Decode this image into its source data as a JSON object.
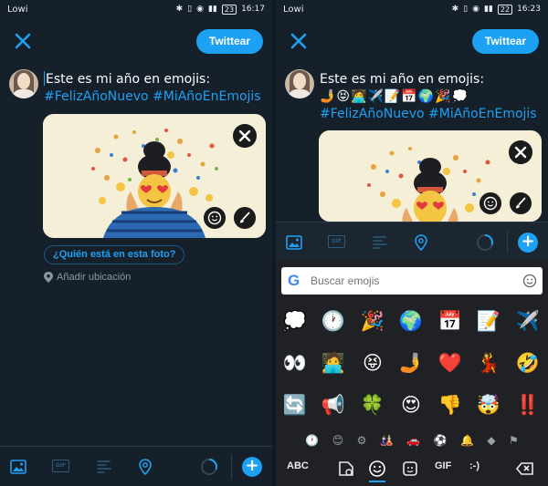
{
  "status_left": {
    "carrier": "Lowi",
    "battery": "23",
    "time": "16:17"
  },
  "status_right": {
    "carrier": "Lowi",
    "battery": "22",
    "time": "16:23"
  },
  "colors": {
    "accent": "#1da1f2",
    "background": "#15202b",
    "keyboard": "#202124"
  },
  "compose": {
    "tweet_button": "Twittear",
    "text_line1": "Este es mi año en emojis:",
    "text_tags": "#FelizAñoNuevo #MiAñoEnEmojis",
    "emoji_line": "🤳😝🧑‍💻✈️📝📅🌍🎉💭"
  },
  "media_actions": {
    "who_in_photo": "¿Quién está en esta foto?",
    "add_location": "Añadir ubicación"
  },
  "toolbar": {
    "gif_label": "GIF"
  },
  "emoji_keyboard": {
    "search_placeholder": "Buscar emojis",
    "google_logo": "G",
    "emojis": [
      "💭",
      "🕐",
      "🎉",
      "🌍",
      "📅",
      "📝",
      "✈️",
      "👀",
      "🧑‍💻",
      "😝",
      "🤳",
      "❤️",
      "💃",
      "🤣",
      "🔄",
      "📢",
      "🍀",
      "😍",
      "👎",
      "🤯",
      "‼️"
    ],
    "categories": [
      "🕐",
      "😊",
      "⚙",
      "🎎",
      "🚗",
      "⚽",
      "🔔",
      "◆",
      "⚑"
    ],
    "keys": {
      "abc": "ABC",
      "gif": "GIF",
      "emoticon": ":-)"
    }
  },
  "icons": [
    "close-icon",
    "image-icon",
    "gif-icon",
    "poll-icon",
    "location-pin-icon",
    "progress-ring-icon",
    "add-icon",
    "sticker-icon",
    "brush-icon",
    "smiley-icon",
    "backspace-icon"
  ]
}
